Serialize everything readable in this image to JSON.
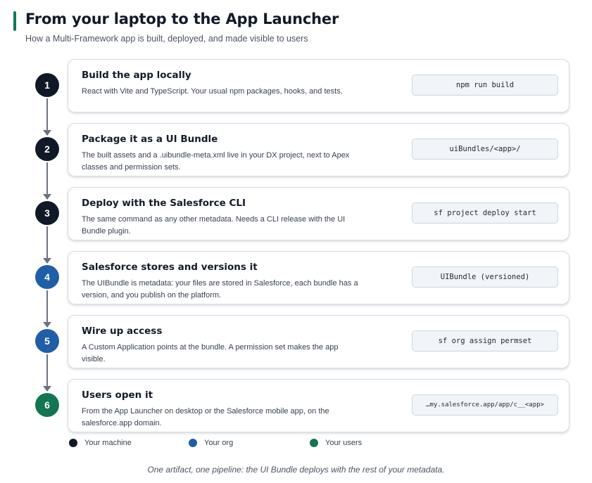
{
  "header": {
    "title": "From your laptop to the App Launcher",
    "subtitle": "How a Multi-Framework app is built, deployed, and made visible to users"
  },
  "colors": {
    "accent_bar": "#0f7a55",
    "machine": "#111827",
    "org": "#1f5fa8",
    "users": "#137552"
  },
  "steps": [
    {
      "number": "1",
      "title": "Build the app locally",
      "description": "React with Vite and TypeScript. Your usual npm packages, hooks, and tests.",
      "code": "npm run build",
      "group": "machine"
    },
    {
      "number": "2",
      "title": "Package it as a UI Bundle",
      "description": "The built assets and a .uibundle-meta.xml live in your DX project, next to Apex classes and permission sets.",
      "code": "uiBundles/<app>/",
      "group": "machine"
    },
    {
      "number": "3",
      "title": "Deploy with the Salesforce CLI",
      "description": "The same command as any other metadata. Needs a CLI release with the UI Bundle plugin.",
      "code": "sf project deploy start",
      "group": "machine"
    },
    {
      "number": "4",
      "title": "Salesforce stores and versions it",
      "description": "The UIBundle is metadata: your files are stored in Salesforce, each bundle has a version, and you publish on the platform.",
      "code": "UIBundle (versioned)",
      "group": "org"
    },
    {
      "number": "5",
      "title": "Wire up access",
      "description": "A Custom Application points at the bundle. A permission set makes the app visible.",
      "code": "sf org assign permset",
      "group": "org"
    },
    {
      "number": "6",
      "title": "Users open it",
      "description": "From the App Launcher on desktop or the Salesforce mobile app, on the salesforce.app domain.",
      "code": "…my.salesforce.app/app/c__<app>",
      "group": "users"
    }
  ],
  "legend": [
    {
      "label": "Your machine",
      "group": "machine"
    },
    {
      "label": "Your org",
      "group": "org"
    },
    {
      "label": "Your users",
      "group": "users"
    }
  ],
  "footer": "One artifact, one pipeline: the UI Bundle deploys with the rest of your metadata."
}
